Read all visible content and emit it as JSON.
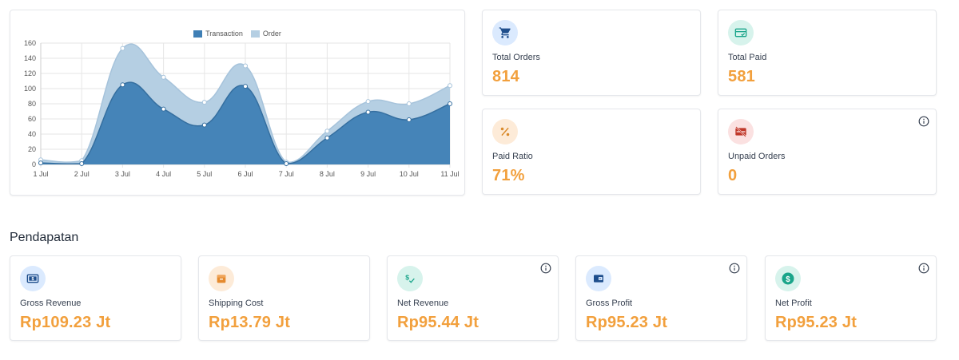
{
  "chart_data": {
    "type": "area",
    "categories": [
      "1 Jul",
      "2 Jul",
      "3 Jul",
      "4 Jul",
      "5 Jul",
      "6 Jul",
      "7 Jul",
      "8 Jul",
      "9 Jul",
      "10 Jul",
      "11 Jul"
    ],
    "series": [
      {
        "name": "Transaction",
        "color": "#3f7fb5",
        "values": [
          2,
          1,
          105,
          73,
          52,
          103,
          1,
          35,
          69,
          59,
          80
        ]
      },
      {
        "name": "Order",
        "color": "#b5cfe3",
        "values": [
          6,
          5,
          153,
          115,
          82,
          130,
          3,
          44,
          83,
          80,
          104
        ]
      }
    ],
    "ylim": [
      0,
      160
    ],
    "yticks": [
      0,
      20,
      40,
      60,
      80,
      100,
      120,
      140,
      160
    ],
    "stacked": false,
    "legend_position": "top",
    "grid": true
  },
  "stats": [
    {
      "label": "Total Orders",
      "value": "814",
      "icon": "cart-icon",
      "bg": "#dbeafe",
      "fg": "#1e4e8c"
    },
    {
      "label": "Total Paid",
      "value": "581",
      "icon": "card-check-icon",
      "bg": "#d7f3ec",
      "fg": "#1aa58a"
    },
    {
      "label": "Paid Ratio",
      "value": "71%",
      "icon": "percent-icon",
      "bg": "#fdebd8",
      "fg": "#d98a2b"
    },
    {
      "label": "Unpaid Orders",
      "value": "0",
      "icon": "card-off-icon",
      "bg": "#fbe1e1",
      "fg": "#c0392b"
    }
  ],
  "section": {
    "title": "Pendapatan"
  },
  "revenue": [
    {
      "label": "Gross Revenue",
      "value": "Rp109.23 Jt",
      "icon": "money-icon",
      "bg": "#dbeafe",
      "fg": "#1e4e8c"
    },
    {
      "label": "Shipping Cost",
      "value": "Rp13.79 Jt",
      "icon": "box-icon",
      "bg": "#fdebd8",
      "fg": "#e58a2e"
    },
    {
      "label": "Net Revenue",
      "value": "Rp95.44 Jt",
      "icon": "dollar-check-icon",
      "bg": "#d7f3ec",
      "fg": "#1aa58a"
    },
    {
      "label": "Gross Profit",
      "value": "Rp95.23 Jt",
      "icon": "wallet-icon",
      "bg": "#dbeafe",
      "fg": "#1e4e8c"
    },
    {
      "label": "Net Profit",
      "value": "Rp95.23 Jt",
      "icon": "dollar-circle-icon",
      "bg": "#d7f3ec",
      "fg": "#1aa58a"
    }
  ]
}
